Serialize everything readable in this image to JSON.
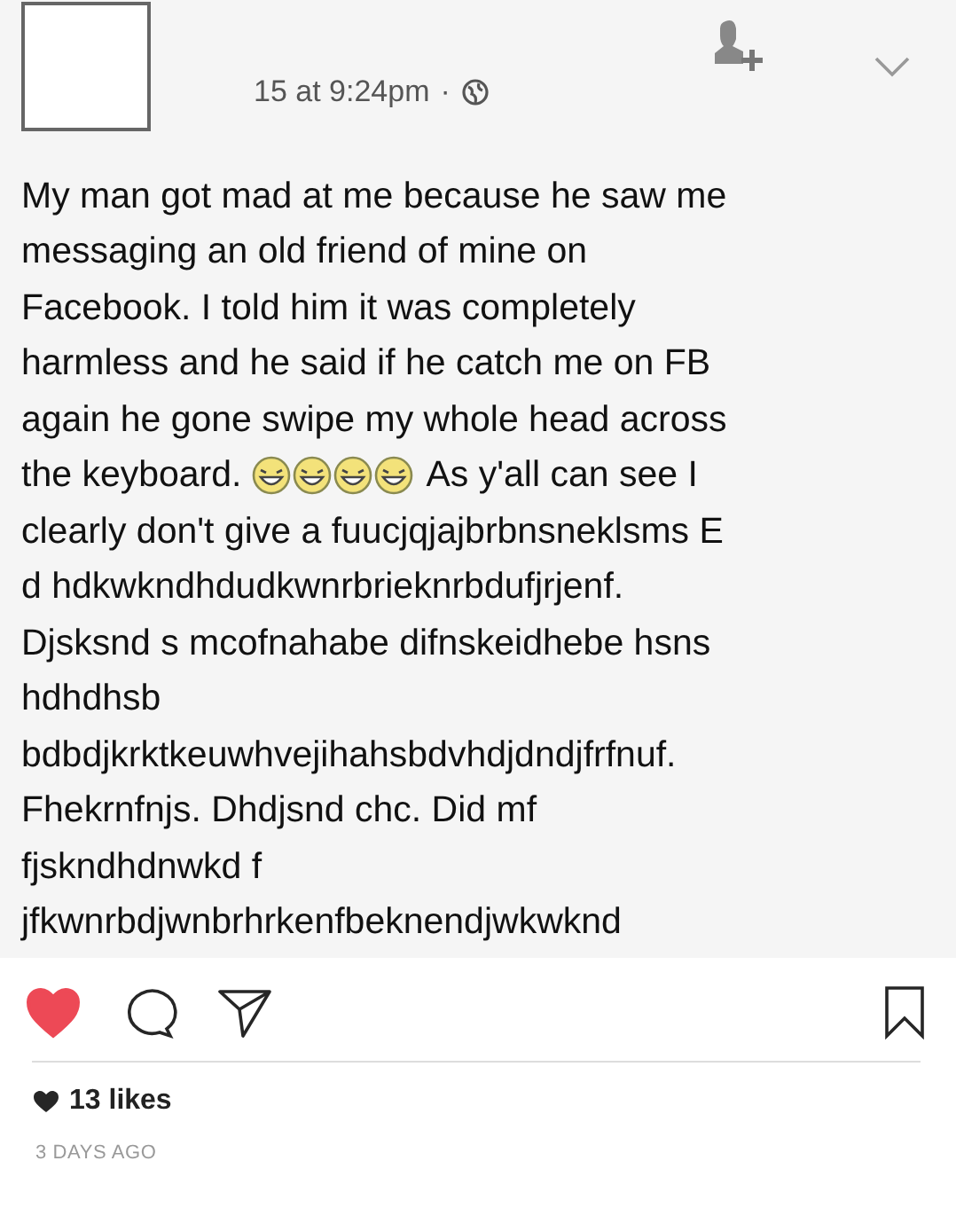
{
  "post": {
    "timestamp": "15 at 9:24pm",
    "separator": "·",
    "lines": [
      {
        "segments": [
          {
            "kind": "text",
            "text": "My man got mad at me because he saw me"
          }
        ]
      },
      {
        "segments": [
          {
            "kind": "text",
            "text": "messaging an old friend of mine on"
          }
        ]
      },
      {
        "segments": [
          {
            "kind": "text",
            "text": "Facebook. I told him it was completely"
          }
        ]
      },
      {
        "segments": [
          {
            "kind": "text",
            "text": "harmless and he said if he catch me on FB"
          }
        ]
      },
      {
        "segments": [
          {
            "kind": "text",
            "text": "again he gone swipe my whole head across"
          }
        ]
      },
      {
        "segments": [
          {
            "kind": "text",
            "text": "the keyboard."
          },
          {
            "kind": "emoji"
          },
          {
            "kind": "emoji"
          },
          {
            "kind": "emoji"
          },
          {
            "kind": "emoji"
          },
          {
            "kind": "text",
            "text": "As y'all can see I"
          }
        ]
      },
      {
        "segments": [
          {
            "kind": "text",
            "text": "clearly don't give a fuucjqjajbrbnsneklsms E"
          }
        ]
      },
      {
        "segments": [
          {
            "kind": "text",
            "text": "d hdkwkndhdudkwnrbrieknrbdufjrjenf."
          }
        ]
      },
      {
        "segments": [
          {
            "kind": "text",
            "text": "Djsksnd s mcofnahabe difnskeidhebe hsns"
          }
        ]
      },
      {
        "segments": [
          {
            "kind": "text",
            "text": "hdhdhsb"
          }
        ]
      },
      {
        "segments": [
          {
            "kind": "text",
            "text": "bdbdjkrktkeuwhvejihahsbdvhdjdndjfrfnuf."
          }
        ]
      },
      {
        "segments": [
          {
            "kind": "text",
            "text": "Fhekrnfnjs. Dhdjsnd chc. Did mf"
          }
        ]
      },
      {
        "segments": [
          {
            "kind": "text",
            "text": "fjskndhdnwkd f"
          }
        ]
      },
      {
        "segments": [
          {
            "kind": "text",
            "text": "jfkwnrbdjwnbrhrkenfbeknendjwkwknd"
          }
        ]
      }
    ]
  },
  "actions": {
    "liked": true,
    "saved": false
  },
  "likes": "13 likes",
  "age": "3 DAYS AGO"
}
